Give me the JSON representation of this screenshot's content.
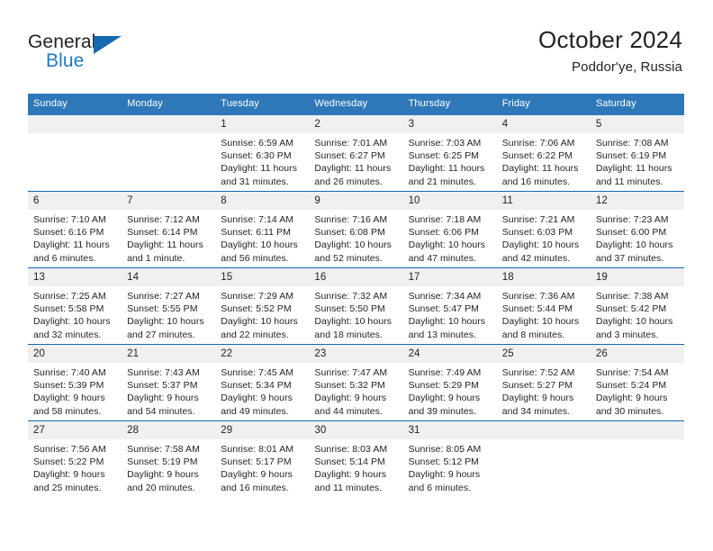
{
  "brand": {
    "word_one": "General",
    "word_two": "Blue",
    "triangle_icon": "triangle-icon"
  },
  "header": {
    "title": "October 2024",
    "subtitle": "Poddor'ye, Russia"
  },
  "colors": {
    "header_blue": "#2e78b9",
    "rule_blue": "#1668b1",
    "daynum_band": "#f0f0f0",
    "brand_blue": "#1f7ac4",
    "text": "#231f20"
  },
  "weekdays": [
    "Sunday",
    "Monday",
    "Tuesday",
    "Wednesday",
    "Thursday",
    "Friday",
    "Saturday"
  ],
  "labels": {
    "sunrise_prefix": "Sunrise:",
    "sunset_prefix": "Sunset:",
    "daylight_prefix": "Daylight:"
  },
  "weeks": [
    [
      {
        "day": "",
        "empty": true
      },
      {
        "day": "",
        "empty": true
      },
      {
        "day": "1",
        "sunrise": "Sunrise: 6:59 AM",
        "sunset": "Sunset: 6:30 PM",
        "daylight_l1": "Daylight: 11 hours",
        "daylight_l2": "and 31 minutes."
      },
      {
        "day": "2",
        "sunrise": "Sunrise: 7:01 AM",
        "sunset": "Sunset: 6:27 PM",
        "daylight_l1": "Daylight: 11 hours",
        "daylight_l2": "and 26 minutes."
      },
      {
        "day": "3",
        "sunrise": "Sunrise: 7:03 AM",
        "sunset": "Sunset: 6:25 PM",
        "daylight_l1": "Daylight: 11 hours",
        "daylight_l2": "and 21 minutes."
      },
      {
        "day": "4",
        "sunrise": "Sunrise: 7:06 AM",
        "sunset": "Sunset: 6:22 PM",
        "daylight_l1": "Daylight: 11 hours",
        "daylight_l2": "and 16 minutes."
      },
      {
        "day": "5",
        "sunrise": "Sunrise: 7:08 AM",
        "sunset": "Sunset: 6:19 PM",
        "daylight_l1": "Daylight: 11 hours",
        "daylight_l2": "and 11 minutes."
      }
    ],
    [
      {
        "day": "6",
        "sunrise": "Sunrise: 7:10 AM",
        "sunset": "Sunset: 6:16 PM",
        "daylight_l1": "Daylight: 11 hours",
        "daylight_l2": "and 6 minutes."
      },
      {
        "day": "7",
        "sunrise": "Sunrise: 7:12 AM",
        "sunset": "Sunset: 6:14 PM",
        "daylight_l1": "Daylight: 11 hours",
        "daylight_l2": "and 1 minute."
      },
      {
        "day": "8",
        "sunrise": "Sunrise: 7:14 AM",
        "sunset": "Sunset: 6:11 PM",
        "daylight_l1": "Daylight: 10 hours",
        "daylight_l2": "and 56 minutes."
      },
      {
        "day": "9",
        "sunrise": "Sunrise: 7:16 AM",
        "sunset": "Sunset: 6:08 PM",
        "daylight_l1": "Daylight: 10 hours",
        "daylight_l2": "and 52 minutes."
      },
      {
        "day": "10",
        "sunrise": "Sunrise: 7:18 AM",
        "sunset": "Sunset: 6:06 PM",
        "daylight_l1": "Daylight: 10 hours",
        "daylight_l2": "and 47 minutes."
      },
      {
        "day": "11",
        "sunrise": "Sunrise: 7:21 AM",
        "sunset": "Sunset: 6:03 PM",
        "daylight_l1": "Daylight: 10 hours",
        "daylight_l2": "and 42 minutes."
      },
      {
        "day": "12",
        "sunrise": "Sunrise: 7:23 AM",
        "sunset": "Sunset: 6:00 PM",
        "daylight_l1": "Daylight: 10 hours",
        "daylight_l2": "and 37 minutes."
      }
    ],
    [
      {
        "day": "13",
        "sunrise": "Sunrise: 7:25 AM",
        "sunset": "Sunset: 5:58 PM",
        "daylight_l1": "Daylight: 10 hours",
        "daylight_l2": "and 32 minutes."
      },
      {
        "day": "14",
        "sunrise": "Sunrise: 7:27 AM",
        "sunset": "Sunset: 5:55 PM",
        "daylight_l1": "Daylight: 10 hours",
        "daylight_l2": "and 27 minutes."
      },
      {
        "day": "15",
        "sunrise": "Sunrise: 7:29 AM",
        "sunset": "Sunset: 5:52 PM",
        "daylight_l1": "Daylight: 10 hours",
        "daylight_l2": "and 22 minutes."
      },
      {
        "day": "16",
        "sunrise": "Sunrise: 7:32 AM",
        "sunset": "Sunset: 5:50 PM",
        "daylight_l1": "Daylight: 10 hours",
        "daylight_l2": "and 18 minutes."
      },
      {
        "day": "17",
        "sunrise": "Sunrise: 7:34 AM",
        "sunset": "Sunset: 5:47 PM",
        "daylight_l1": "Daylight: 10 hours",
        "daylight_l2": "and 13 minutes."
      },
      {
        "day": "18",
        "sunrise": "Sunrise: 7:36 AM",
        "sunset": "Sunset: 5:44 PM",
        "daylight_l1": "Daylight: 10 hours",
        "daylight_l2": "and 8 minutes."
      },
      {
        "day": "19",
        "sunrise": "Sunrise: 7:38 AM",
        "sunset": "Sunset: 5:42 PM",
        "daylight_l1": "Daylight: 10 hours",
        "daylight_l2": "and 3 minutes."
      }
    ],
    [
      {
        "day": "20",
        "sunrise": "Sunrise: 7:40 AM",
        "sunset": "Sunset: 5:39 PM",
        "daylight_l1": "Daylight: 9 hours",
        "daylight_l2": "and 58 minutes."
      },
      {
        "day": "21",
        "sunrise": "Sunrise: 7:43 AM",
        "sunset": "Sunset: 5:37 PM",
        "daylight_l1": "Daylight: 9 hours",
        "daylight_l2": "and 54 minutes."
      },
      {
        "day": "22",
        "sunrise": "Sunrise: 7:45 AM",
        "sunset": "Sunset: 5:34 PM",
        "daylight_l1": "Daylight: 9 hours",
        "daylight_l2": "and 49 minutes."
      },
      {
        "day": "23",
        "sunrise": "Sunrise: 7:47 AM",
        "sunset": "Sunset: 5:32 PM",
        "daylight_l1": "Daylight: 9 hours",
        "daylight_l2": "and 44 minutes."
      },
      {
        "day": "24",
        "sunrise": "Sunrise: 7:49 AM",
        "sunset": "Sunset: 5:29 PM",
        "daylight_l1": "Daylight: 9 hours",
        "daylight_l2": "and 39 minutes."
      },
      {
        "day": "25",
        "sunrise": "Sunrise: 7:52 AM",
        "sunset": "Sunset: 5:27 PM",
        "daylight_l1": "Daylight: 9 hours",
        "daylight_l2": "and 34 minutes."
      },
      {
        "day": "26",
        "sunrise": "Sunrise: 7:54 AM",
        "sunset": "Sunset: 5:24 PM",
        "daylight_l1": "Daylight: 9 hours",
        "daylight_l2": "and 30 minutes."
      }
    ],
    [
      {
        "day": "27",
        "sunrise": "Sunrise: 7:56 AM",
        "sunset": "Sunset: 5:22 PM",
        "daylight_l1": "Daylight: 9 hours",
        "daylight_l2": "and 25 minutes."
      },
      {
        "day": "28",
        "sunrise": "Sunrise: 7:58 AM",
        "sunset": "Sunset: 5:19 PM",
        "daylight_l1": "Daylight: 9 hours",
        "daylight_l2": "and 20 minutes."
      },
      {
        "day": "29",
        "sunrise": "Sunrise: 8:01 AM",
        "sunset": "Sunset: 5:17 PM",
        "daylight_l1": "Daylight: 9 hours",
        "daylight_l2": "and 16 minutes."
      },
      {
        "day": "30",
        "sunrise": "Sunrise: 8:03 AM",
        "sunset": "Sunset: 5:14 PM",
        "daylight_l1": "Daylight: 9 hours",
        "daylight_l2": "and 11 minutes."
      },
      {
        "day": "31",
        "sunrise": "Sunrise: 8:05 AM",
        "sunset": "Sunset: 5:12 PM",
        "daylight_l1": "Daylight: 9 hours",
        "daylight_l2": "and 6 minutes."
      },
      {
        "day": "",
        "empty": true
      },
      {
        "day": "",
        "empty": true
      }
    ]
  ]
}
